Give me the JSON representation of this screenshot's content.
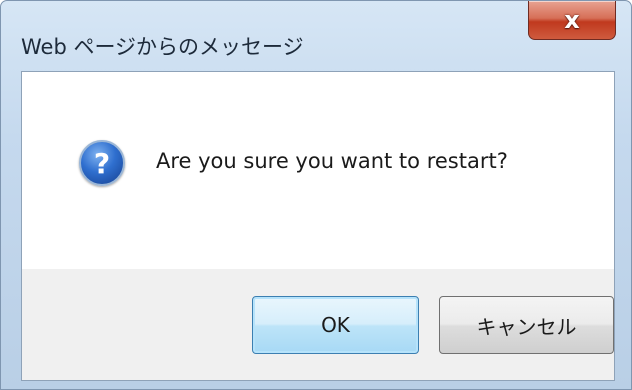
{
  "window": {
    "title": "Web ページからのメッセージ",
    "close_icon": "close-icon",
    "close_glyph": "x"
  },
  "dialog": {
    "icon": "question-icon",
    "icon_glyph": "?",
    "message": "Are you sure you want to restart?"
  },
  "buttons": {
    "ok_label": "OK",
    "cancel_label": "キャンセル"
  }
}
